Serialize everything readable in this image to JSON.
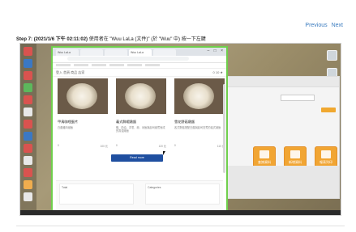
{
  "nav": {
    "previous": "Previous",
    "next": "Next"
  },
  "step": {
    "label": "Step 7:",
    "time": "(2021/1/6 下午 02:11:02)",
    "text": " 使用者在 \"Wuu LaLa (文件)\" (於 \"Wuu\" 中) 按一下左鍵"
  },
  "browser": {
    "tabs": [
      "Wuu LaLa",
      "",
      "",
      "Wuu LaLa",
      ""
    ],
    "window_controls": "– □ ×",
    "appbar_left": "登入  首頁  商品  店家",
    "appbar_right": "0  10  ★"
  },
  "cards": [
    {
      "title": "甲鳥咖哩蛋片",
      "desc": "白醬雞肉燉飯",
      "meta_left": "0",
      "meta_right": "100 元"
    },
    {
      "title": "義式鮮蝦燉飯",
      "desc": "蝦、奶油、洋蔥、蒜、米飯與起司燉煮而成的香濃燉飯",
      "meta_left": "0",
      "meta_right": "120 元"
    },
    {
      "title": "雪花野菇燉飯",
      "desc": "各式野菇搭配白醬與起司熬煮的義式燉飯",
      "meta_left": "0",
      "meta_right": "110 元"
    }
  ],
  "more_button": "Read more",
  "footer": {
    "left": "Total",
    "right": "Categories"
  },
  "backapp": {
    "tiles": [
      "查詢資料",
      "新增資料",
      "報表列印"
    ]
  },
  "colors": {
    "accent_orange": "#f1a533",
    "browser_border": "#6fcf4c",
    "button_blue": "#1f4fa0",
    "link_blue": "#3a7bbf"
  }
}
